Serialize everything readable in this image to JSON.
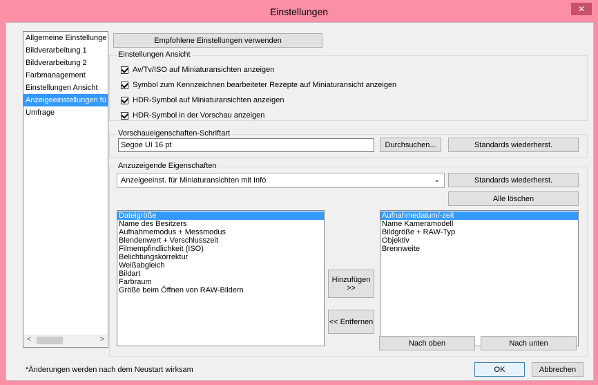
{
  "window": {
    "title": "Einstellungen",
    "close_label": "✕"
  },
  "nav": {
    "items": [
      {
        "label": "Allgemeine Einstellunge"
      },
      {
        "label": "Bildverarbeitung 1"
      },
      {
        "label": "Bildverarbeitung 2"
      },
      {
        "label": "Farbmanagement"
      },
      {
        "label": "Einstellungen Ansicht"
      },
      {
        "label": "Anzeigeeinstellungen fü",
        "selected": true
      },
      {
        "label": "Umfrage"
      }
    ],
    "scroll_left": "<",
    "scroll_right": ">"
  },
  "top_button": "Empfohlene Einstellungen verwenden",
  "view_settings": {
    "label": "Einstellungen Ansicht",
    "checkboxes": [
      {
        "label": "Av/Tv/ISO auf Miniaturansichten anzeigen",
        "checked": true
      },
      {
        "label": "Symbol zum Kennzeichnen bearbeiteter Rezepte auf Miniaturansicht anzeigen",
        "checked": true
      },
      {
        "label": "HDR-Symbol auf Miniaturansichten anzeigen",
        "checked": true
      },
      {
        "label": "HDR-Symbol in der Vorschau anzeigen",
        "checked": true
      }
    ]
  },
  "preview_font": {
    "label": "Vorschaueigenschaften-Schriftart",
    "value": "Segoe UI 16 pt",
    "browse": "Durchsuchen...",
    "reset": "Standards wiederherst."
  },
  "display_props": {
    "label": "Anzuzeigende Eigenschaften",
    "combo_value": "Anzeigeeinst. für Miniaturansichten mit Info",
    "reset": "Standards wiederherst.",
    "clear_all": "Alle löschen",
    "available": [
      "Dateigröße",
      "Name des Besitzers",
      "Aufnahmemodus + Messmodus",
      "Blendenwert + Verschlusszeit",
      "Filmempfindlichkeit (ISO)",
      "Belichtungskorrektur",
      "Weißabgleich",
      "Bildart",
      "Farbraum",
      "Größe beim Öffnen von RAW-Bildern"
    ],
    "selected": [
      "Aufnahmedatum/-zeit",
      "Name Kameramodell",
      "Bildgröße + RAW-Typ",
      "Objektiv",
      "Brennweite"
    ],
    "add_line1": "Hinzufügen",
    "add_line2": ">>",
    "remove": "<< Entfernen",
    "move_up": "Nach oben",
    "move_down": "Nach unten"
  },
  "footer": {
    "note": "*Änderungen werden nach dem Neustart wirksam",
    "ok": "OK",
    "cancel": "Abbrechen"
  }
}
